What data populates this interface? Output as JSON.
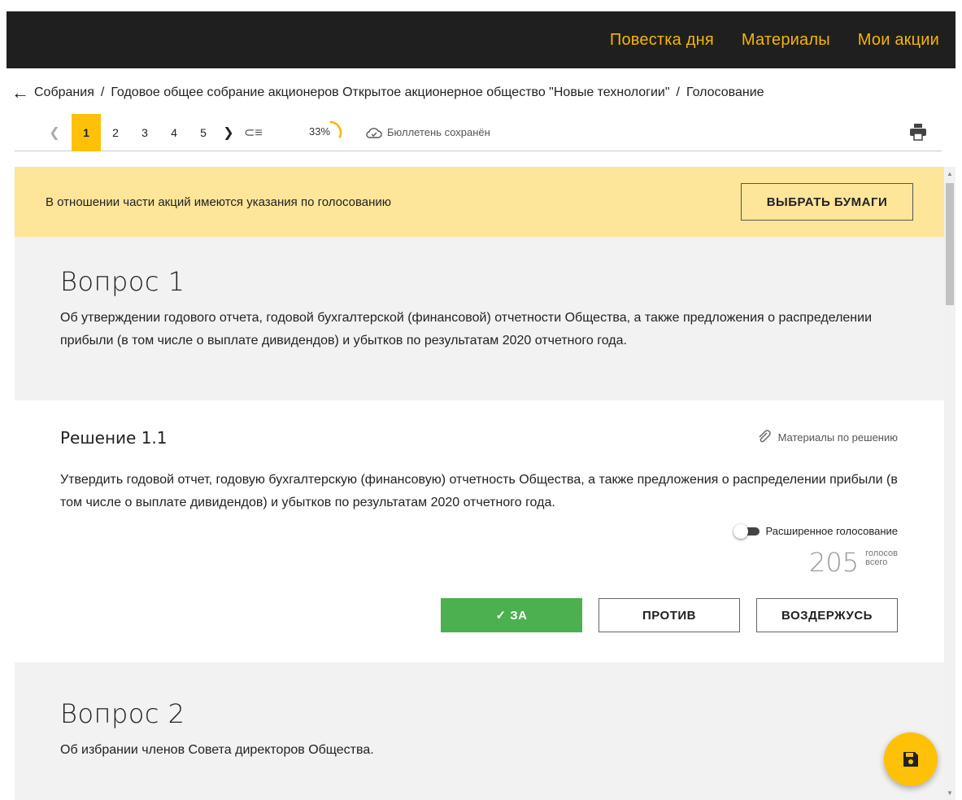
{
  "nav": {
    "items": [
      "Повестка дня",
      "Материалы",
      "Мои акции"
    ]
  },
  "breadcrumb": {
    "back_icon": "arrow-left-icon",
    "items": [
      "Собрания",
      "Годовое общее собрание акционеров Открытое акционерное общество \"Новые технологии\"",
      "Голосование"
    ]
  },
  "pager": {
    "pages": [
      "1",
      "2",
      "3",
      "4",
      "5"
    ],
    "active_page": "1",
    "progress": "33%",
    "progress_fraction": 0.33,
    "saved_text": "Бюллетень сохранён"
  },
  "notice": {
    "text": "В отношении части акций имеются указания по голосованию",
    "button": "ВЫБРАТЬ БУМАГИ"
  },
  "questions": [
    {
      "title": "Вопрос 1",
      "text": "Об утверждении годового отчета, годовой бухгалтерской (финансовой) отчетности Общества, а также предложения о распределении прибыли (в том числе о выплате дивидендов) и убытков по результатам 2020 отчетного года.",
      "decision": {
        "title": "Решение 1.1",
        "materials": "Материалы по решению",
        "text": "Утвердить годовой отчет, годовую бухгалтерскую (финансовую) отчетность  Общества, а также предложения  о распределении прибыли (в том числе о выплате дивидендов) и убытков по результатам 2020 отчетного года.",
        "extended_label": "Расширенное голосование",
        "votes_count": "205",
        "votes_label_1": "голосов",
        "votes_label_2": "всего",
        "vote_for": "ЗА",
        "vote_against": "ПРОТИВ",
        "vote_abstain": "ВОЗДЕРЖУСЬ",
        "selected": "ЗА"
      }
    },
    {
      "title": "Вопрос 2",
      "text": "Об избрании членов Совета директоров Общества."
    }
  ],
  "colors": {
    "accent": "#f5b500",
    "fab": "#ffc107",
    "notice_bg": "#fde59a",
    "vote_for": "#4caf50",
    "topbar": "#1f1f1f"
  }
}
